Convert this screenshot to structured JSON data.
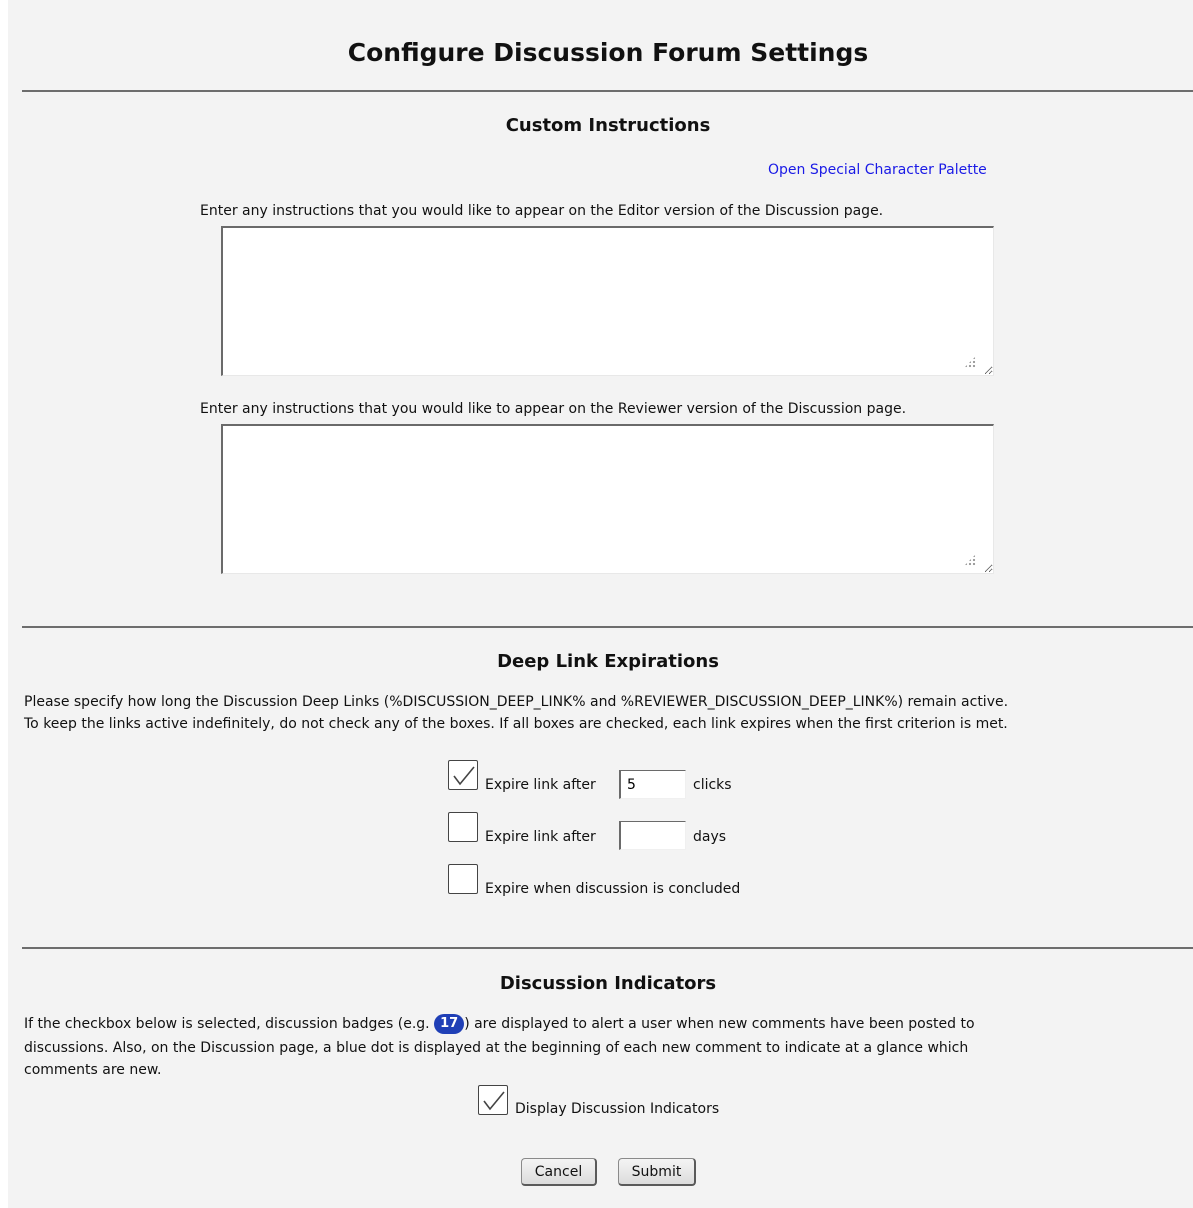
{
  "page": {
    "title": "Configure Discussion Forum Settings"
  },
  "custom_instructions": {
    "heading": "Custom Instructions",
    "palette_link": "Open Special Character Palette",
    "editor_label": "Enter any instructions that you would like to appear on the Editor version of the Discussion page.",
    "editor_value": "",
    "reviewer_label": "Enter any instructions that you would like to appear on the Reviewer version of the Discussion page.",
    "reviewer_value": ""
  },
  "deep_links": {
    "heading": "Deep Link Expirations",
    "description_line1": "Please specify how long the Discussion Deep Links (%DISCUSSION_DEEP_LINK% and %REVIEWER_DISCUSSION_DEEP_LINK%) remain active.",
    "description_line2": "To keep the links active indefinitely, do not check any of the boxes. If all boxes are checked, each link expires when the first criterion is met.",
    "options": [
      {
        "label": "Expire link after",
        "checked": true,
        "value": "5",
        "unit": "clicks"
      },
      {
        "label": "Expire link after",
        "checked": false,
        "value": "",
        "unit": "days"
      },
      {
        "label": "Expire when discussion is concluded",
        "checked": false
      }
    ]
  },
  "indicators": {
    "heading": "Discussion Indicators",
    "text_before_badge": "If the checkbox below is selected, discussion badges (e.g. ",
    "badge_example": "17",
    "text_after_badge": ") are displayed to alert a user when new comments have been posted to",
    "text_line2": "discussions. Also, on the Discussion page, a blue dot is displayed at the beginning of each new comment to indicate at a glance which",
    "text_line3": "comments are new.",
    "checkbox_label": "Display Discussion Indicators",
    "checked": true
  },
  "actions": {
    "cancel_label": "Cancel",
    "submit_label": "Submit"
  }
}
